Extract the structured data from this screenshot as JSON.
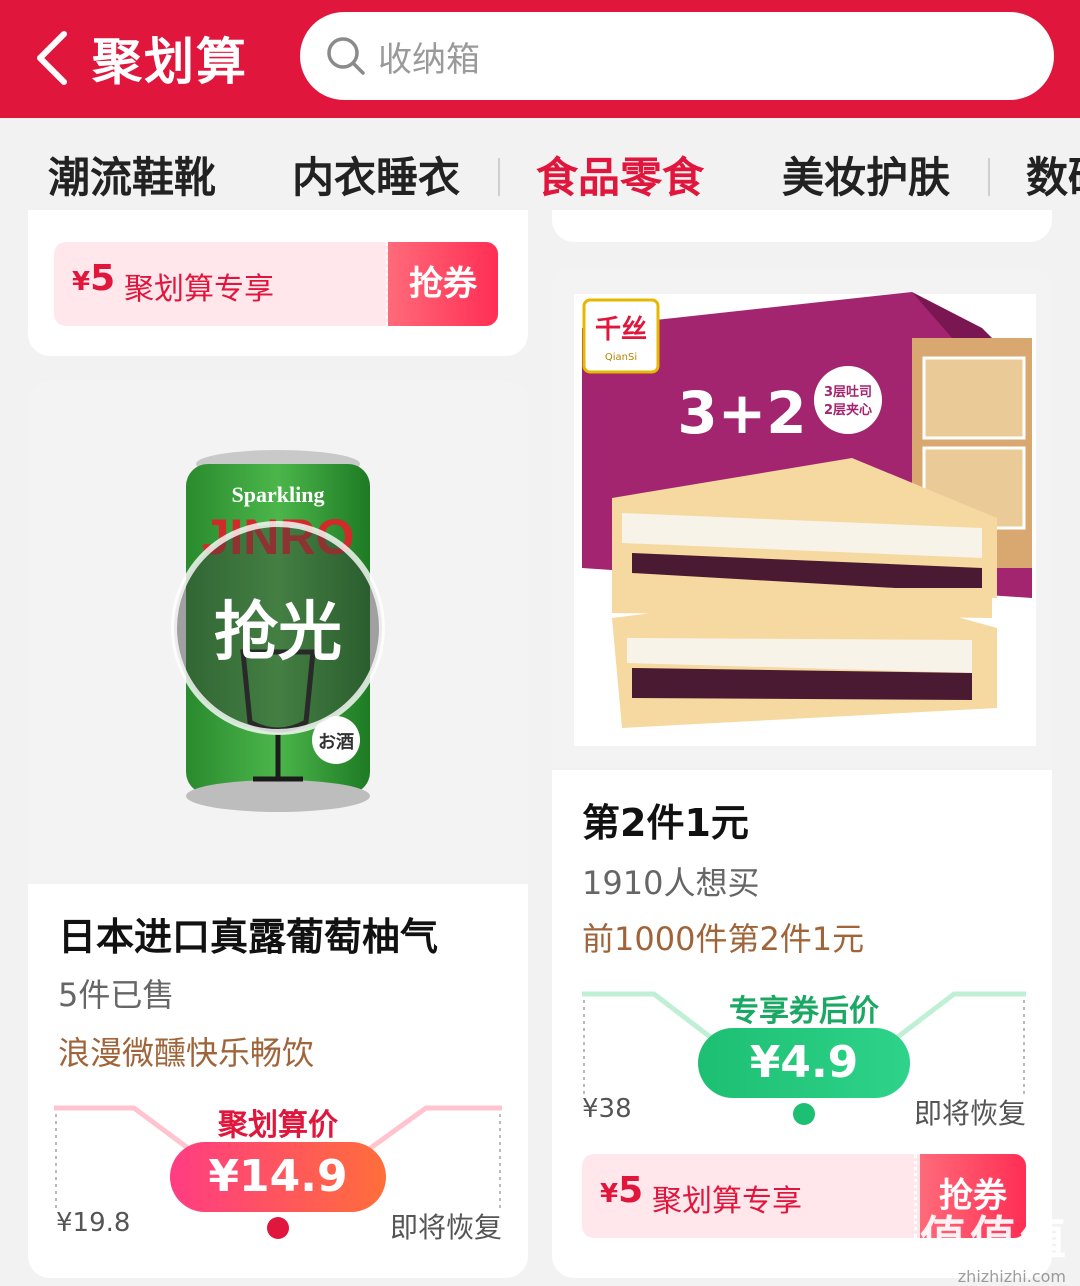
{
  "header": {
    "brand": "聚划算",
    "search_placeholder": "收纳箱",
    "bg_color": "#e0163c"
  },
  "tabs": [
    {
      "label": "潮流鞋靴"
    },
    {
      "label": "内衣睡衣"
    },
    {
      "label": "食品零食",
      "active": true
    },
    {
      "label": "美妆护肤"
    },
    {
      "label": "数码"
    }
  ],
  "top_left_coupon": {
    "currency": "¥",
    "amount": "5",
    "label": "聚划算专享",
    "button": "抢券"
  },
  "product_left": {
    "overlay": "抢光",
    "can_text": {
      "brand_top": "Sparkling",
      "brand": "JINRO",
      "badge": "お酒"
    },
    "title": "日本进口真露葡萄柚气",
    "sold": "5件已售",
    "promo": "浪漫微醺快乐畅饮",
    "price_caption": "聚划算价",
    "price": "¥14.9",
    "old_price": "¥19.8",
    "restore": "即将恢复"
  },
  "product_right": {
    "logo": "千丝",
    "logo_sub": "QianSi",
    "box_text": "3+2",
    "box_note_1": "3层吐司",
    "box_note_2": "2层夹心",
    "title": "第2件1元",
    "want": "1910人想买",
    "promo": "前1000件第2件1元",
    "price_caption": "专享券后价",
    "price": "¥4.9",
    "old_price": "¥38",
    "restore": "即将恢复",
    "coupon": {
      "currency": "¥",
      "amount": "5",
      "label": "聚划算专享",
      "button": "抢券"
    }
  },
  "watermark": {
    "text": "值值值",
    "sub": "zhizhizhi.com"
  },
  "colors": {
    "accent": "#e0163c",
    "green": "#1dbf72",
    "promo_brown": "#a0643a"
  }
}
